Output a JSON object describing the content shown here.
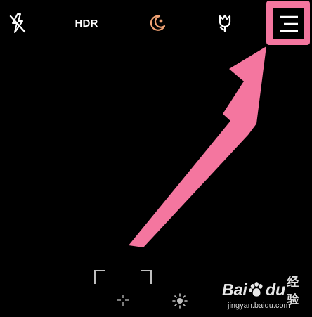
{
  "topbar": {
    "flash_icon": "flash-off-icon",
    "hdr_label": "HDR",
    "night_icon": "night-mode-moon-icon",
    "macro_icon": "macro-tulip-icon",
    "menu_icon": "hamburger-menu-icon"
  },
  "annotation": {
    "highlight_color": "#f4769f",
    "arrow_icon": "pointer-arrow-icon"
  },
  "viewfinder": {
    "focus_icon": "focus-frame-icon",
    "focus_point_icon": "focus-point-icon",
    "exposure_icon": "sun-exposure-icon"
  },
  "watermark": {
    "brand_left": "Bai",
    "brand_right": "du",
    "brand_suffix": "经验",
    "url": "jingyan.baidu.com",
    "paw_icon": "baidu-paw-icon"
  }
}
